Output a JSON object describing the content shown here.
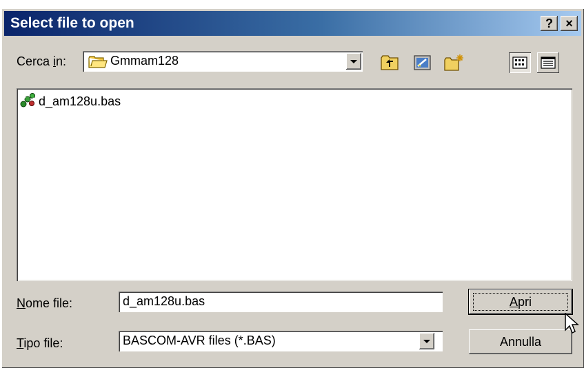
{
  "window": {
    "title": "Select file to open"
  },
  "title_buttons": {
    "help": "?",
    "close": "×"
  },
  "look_in": {
    "label_pre": "Cerca ",
    "label_key": "i",
    "label_post": "n:",
    "value": "Gmmam128"
  },
  "toolbar": {
    "icons": [
      "folder-up-icon",
      "desktop-icon",
      "new-folder-icon",
      "list-view-icon",
      "details-view-icon"
    ]
  },
  "files": [
    {
      "name": "d_am128u.bas",
      "icon": "bascom-file-icon"
    }
  ],
  "filename": {
    "label_key": "N",
    "label_post": "ome file:",
    "value": "d_am128u.bas"
  },
  "filetype": {
    "label_key": "T",
    "label_post": "ipo file:",
    "value": "BASCOM-AVR files (*.BAS)"
  },
  "buttons": {
    "open_key": "A",
    "open_post": "pri",
    "cancel": "Annulla"
  },
  "colors": {
    "titlebar_start": "#0a246a",
    "titlebar_end": "#a6caf0",
    "face": "#d4d0c8"
  }
}
